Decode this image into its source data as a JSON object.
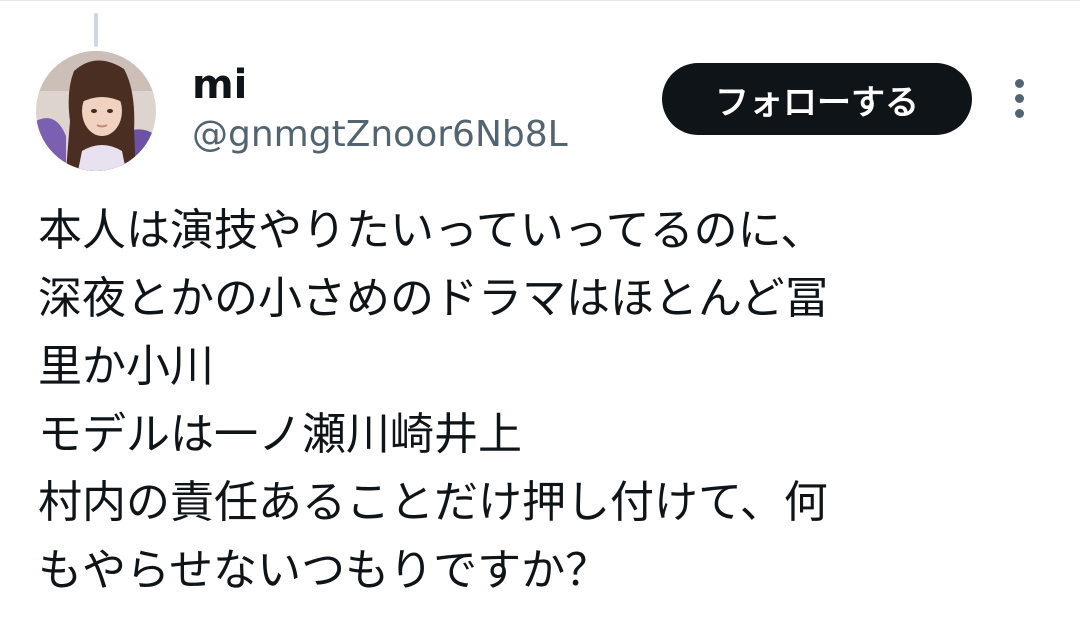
{
  "author": {
    "display_name": "mi",
    "handle": "@gnmgtZnoor6Nb8L"
  },
  "follow_button": {
    "label": "フォローする"
  },
  "more_icon": "more-vertical-icon",
  "tweet_text_lines": [
    "本人は演技やりたいっていってるのに、",
    "深夜とかの小さめのドラマはほとんど冨",
    "里か小川",
    "モデルは一ノ瀬川崎井上",
    "村内の責任あることだけ押し付けて、何",
    "もやらせないつもりですか？"
  ],
  "colors": {
    "text_primary": "#0f1419",
    "text_secondary": "#536471",
    "follow_button_bg": "#0f1419",
    "follow_button_text": "#ffffff"
  }
}
